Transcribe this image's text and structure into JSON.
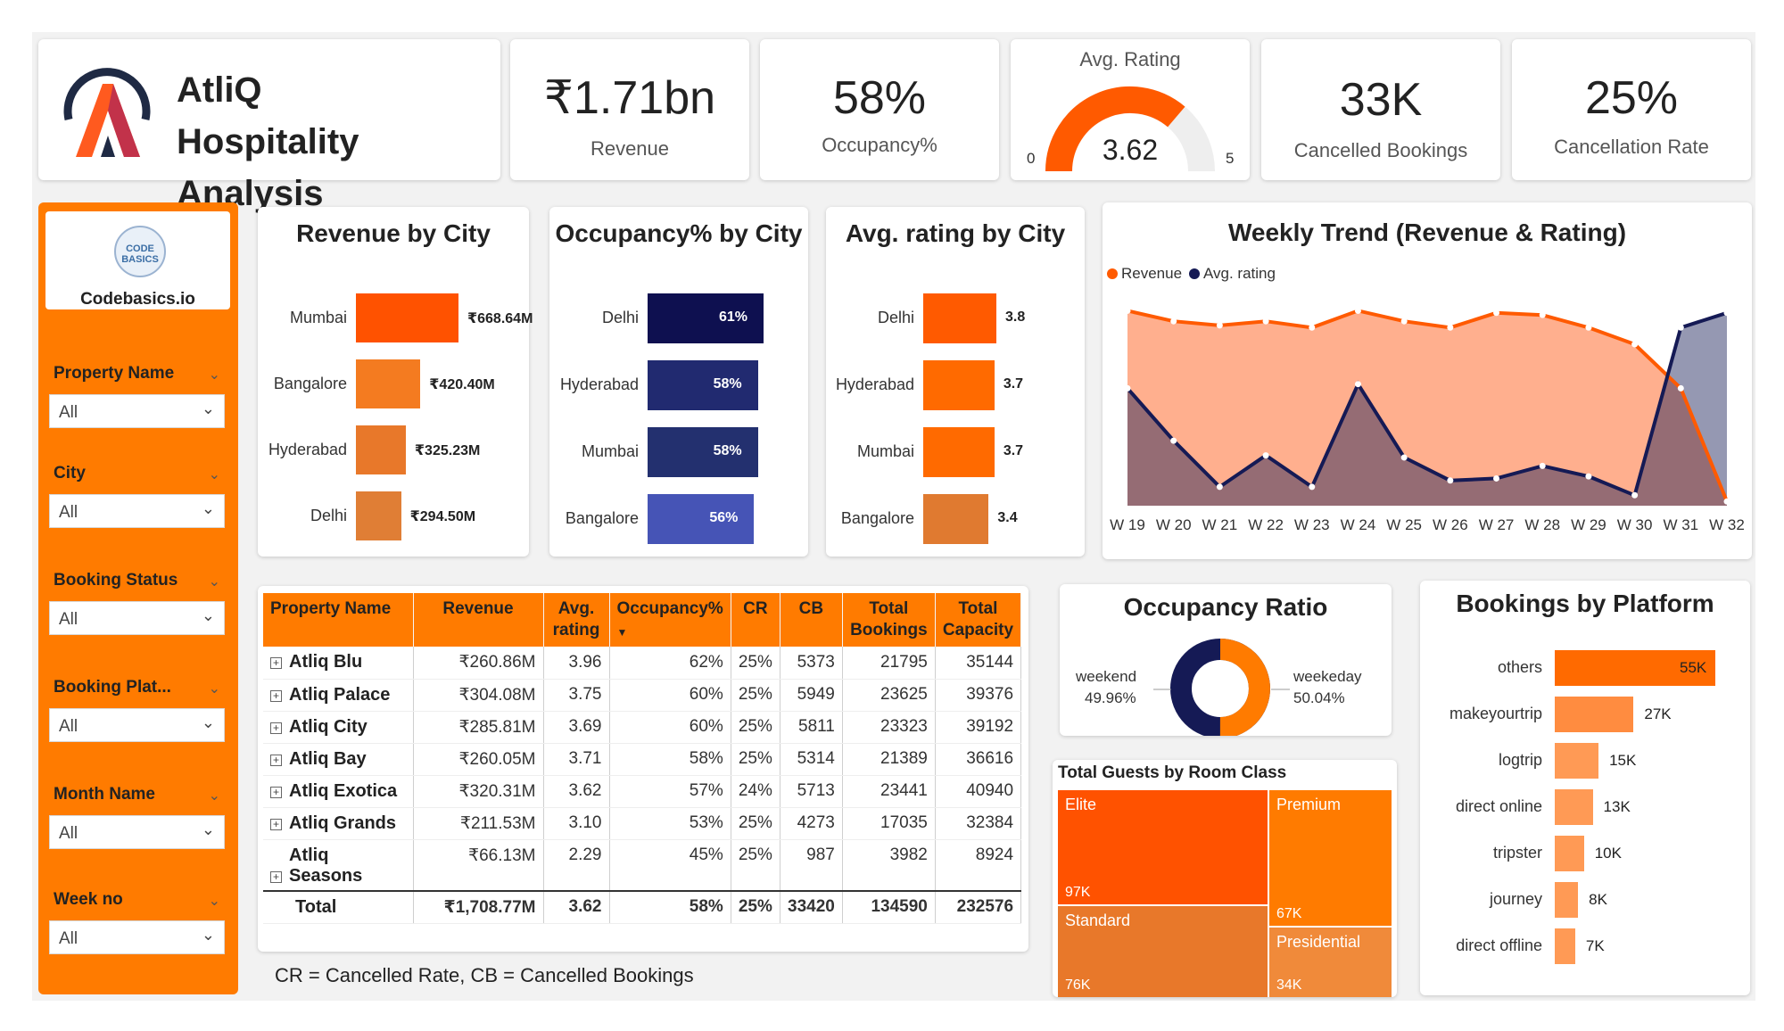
{
  "header": {
    "title": "AtliQ Hospitality Analysis",
    "title_line1": "AtliQ Hospitality",
    "title_line2": "Analysis"
  },
  "kpis": {
    "revenue": {
      "value": "₹1.71bn",
      "label": "Revenue"
    },
    "occupancy": {
      "value": "58%",
      "label": "Occupancy%"
    },
    "rating": {
      "title": "Avg. Rating",
      "value": "3.62",
      "min": "0",
      "max": "5",
      "fraction": 0.724
    },
    "cancelled": {
      "value": "33K",
      "label": "Cancelled Bookings"
    },
    "cancel_rate": {
      "value": "25%",
      "label": "Cancellation Rate"
    }
  },
  "sidebar": {
    "logo_text": "CODE BASICS",
    "brand": "Codebasics.io",
    "slicers": [
      {
        "label": "Property Name",
        "value": "All"
      },
      {
        "label": "City",
        "value": "All"
      },
      {
        "label": "Booking Status",
        "value": "All"
      },
      {
        "label": "Booking Plat...",
        "value": "All"
      },
      {
        "label": "Month Name",
        "value": "All"
      },
      {
        "label": "Week no",
        "value": "All"
      }
    ]
  },
  "revenue_by_city": {
    "title": "Revenue by City",
    "cities": [
      "Mumbai",
      "Bangalore",
      "Hyderabad",
      "Delhi"
    ],
    "values": [
      668.64,
      420.4,
      325.23,
      294.5
    ],
    "labels": [
      "₹668.64M",
      "₹420.40M",
      "₹325.23M",
      "₹294.50M"
    ],
    "colors": [
      "#ff5200",
      "#f47b20",
      "#e8782a",
      "#e07e35"
    ]
  },
  "occupancy_by_city": {
    "title": "Occupancy% by City",
    "cities": [
      "Delhi",
      "Hyderabad",
      "Mumbai",
      "Bangalore"
    ],
    "values": [
      61,
      58,
      58,
      56
    ],
    "labels": [
      "61%",
      "58%",
      "58%",
      "56%"
    ],
    "colors": [
      "#0e1050",
      "#212a70",
      "#23306f",
      "#4654b6"
    ]
  },
  "rating_by_city": {
    "title": "Avg. rating by City",
    "cities": [
      "Delhi",
      "Hyderabad",
      "Mumbai",
      "Bangalore"
    ],
    "values": [
      3.8,
      3.7,
      3.7,
      3.4
    ],
    "labels": [
      "3.8",
      "3.7",
      "3.7",
      "3.4"
    ],
    "colors": [
      "#ff5a00",
      "#ff6a00",
      "#ff6a00",
      "#e07a30"
    ]
  },
  "weekly_trend": {
    "title": "Weekly Trend (Revenue & Rating)",
    "legend": [
      {
        "name": "Revenue",
        "color": "#ff5a00"
      },
      {
        "name": "Avg. rating",
        "color": "#151a55"
      }
    ],
    "weeks": [
      "W 19",
      "W 20",
      "W 21",
      "W 22",
      "W 23",
      "W 24",
      "W 25",
      "W 26",
      "W 27",
      "W 28",
      "W 29",
      "W 30",
      "W 31",
      "W 32"
    ],
    "revenue_rel": [
      0.93,
      0.88,
      0.86,
      0.88,
      0.85,
      0.93,
      0.88,
      0.85,
      0.92,
      0.91,
      0.85,
      0.77,
      0.56,
      0.02
    ],
    "rating_rel": [
      0.56,
      0.31,
      0.09,
      0.24,
      0.09,
      0.58,
      0.23,
      0.12,
      0.13,
      0.19,
      0.14,
      0.05,
      0.85,
      0.92
    ]
  },
  "table": {
    "headers": [
      "Property Name",
      "Revenue",
      "Avg. rating",
      "Occupancy%",
      "CR",
      "CB",
      "Total Bookings",
      "Total Capacity"
    ],
    "sort_indicator": "▼",
    "rows": [
      {
        "name": "Atliq Blu",
        "revenue": "₹260.86M",
        "rating": "3.96",
        "occ": "62%",
        "cr": "25%",
        "cb": "5373",
        "bookings": "21795",
        "capacity": "35144"
      },
      {
        "name": "Atliq Palace",
        "revenue": "₹304.08M",
        "rating": "3.75",
        "occ": "60%",
        "cr": "25%",
        "cb": "5949",
        "bookings": "23625",
        "capacity": "39376"
      },
      {
        "name": "Atliq City",
        "revenue": "₹285.81M",
        "rating": "3.69",
        "occ": "60%",
        "cr": "25%",
        "cb": "5811",
        "bookings": "23323",
        "capacity": "39192"
      },
      {
        "name": "Atliq Bay",
        "revenue": "₹260.05M",
        "rating": "3.71",
        "occ": "58%",
        "cr": "25%",
        "cb": "5314",
        "bookings": "21389",
        "capacity": "36616"
      },
      {
        "name": "Atliq Exotica",
        "revenue": "₹320.31M",
        "rating": "3.62",
        "occ": "57%",
        "cr": "24%",
        "cb": "5713",
        "bookings": "23441",
        "capacity": "40940"
      },
      {
        "name": "Atliq Grands",
        "revenue": "₹211.53M",
        "rating": "3.10",
        "occ": "53%",
        "cr": "25%",
        "cb": "4273",
        "bookings": "17035",
        "capacity": "32384"
      },
      {
        "name": "Atliq Seasons",
        "revenue": "₹66.13M",
        "rating": "2.29",
        "occ": "45%",
        "cr": "25%",
        "cb": "987",
        "bookings": "3982",
        "capacity": "8924"
      }
    ],
    "total": {
      "name": "Total",
      "revenue": "₹1,708.77M",
      "rating": "3.62",
      "occ": "58%",
      "cr": "25%",
      "cb": "33420",
      "bookings": "134590",
      "capacity": "232576"
    },
    "footnote": "CR = Cancelled Rate, CB = Cancelled Bookings"
  },
  "occupancy_ratio": {
    "title": "Occupancy Ratio",
    "weekend_label": "weekend",
    "weekend_value": "49.96%",
    "weekend_fraction": 0.4996,
    "weekday_label": "weekeday",
    "weekday_value": "50.04%",
    "colors": {
      "weekend": "#151a55",
      "weekday": "#ff7b00"
    }
  },
  "room_class": {
    "title": "Total Guests by Room Class",
    "items": [
      {
        "name": "Elite",
        "value": "97K",
        "color": "#ff5200"
      },
      {
        "name": "Premium",
        "value": "67K",
        "color": "#ff7b00"
      },
      {
        "name": "Standard",
        "value": "76K",
        "color": "#e8782a"
      },
      {
        "name": "Presidential",
        "value": "34K",
        "color": "#f08a3a"
      }
    ]
  },
  "platform": {
    "title": "Bookings by Platform",
    "names": [
      "others",
      "makeyourtrip",
      "logtrip",
      "direct online",
      "tripster",
      "journey",
      "direct offline"
    ],
    "values": [
      55,
      27,
      15,
      13,
      10,
      8,
      7
    ],
    "labels": [
      "55K",
      "27K",
      "15K",
      "13K",
      "10K",
      "8K",
      "7K"
    ],
    "colors": [
      "#ff6a00",
      "#ff8c40",
      "#ff9a55",
      "#ff9a55",
      "#ff9a55",
      "#ff9a55",
      "#ff9a55"
    ]
  }
}
